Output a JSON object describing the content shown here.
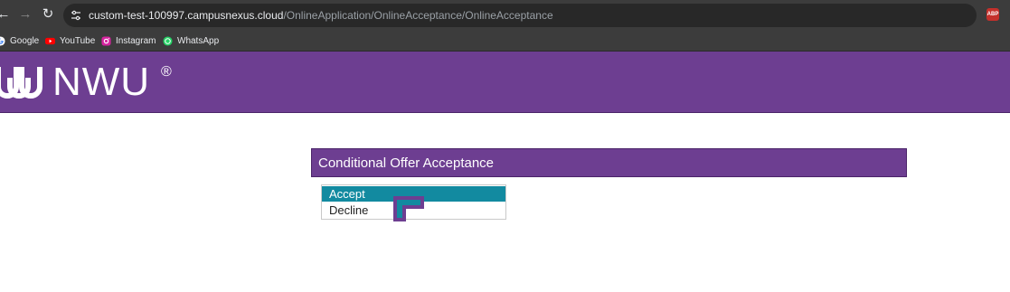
{
  "browser": {
    "url_host": "custom-test-100997.campusnexus.cloud",
    "url_path": "/OnlineApplication/OnlineAcceptance/OnlineAcceptance",
    "bookmarks": [
      {
        "label": "Google",
        "icon": "google-icon"
      },
      {
        "label": "YouTube",
        "icon": "youtube-icon"
      },
      {
        "label": "Instagram",
        "icon": "instagram-icon"
      },
      {
        "label": "WhatsApp",
        "icon": "whatsapp-icon"
      }
    ],
    "extension_label": "ABP"
  },
  "header": {
    "logo_text": "NWU",
    "registered_mark": "®",
    "brand_color": "#6d3e91"
  },
  "panel": {
    "title": "Conditional Offer Acceptance"
  },
  "dropdown": {
    "options": [
      "Accept",
      "Decline"
    ],
    "selected_index": 0,
    "highlight_color": "#128aa0"
  }
}
